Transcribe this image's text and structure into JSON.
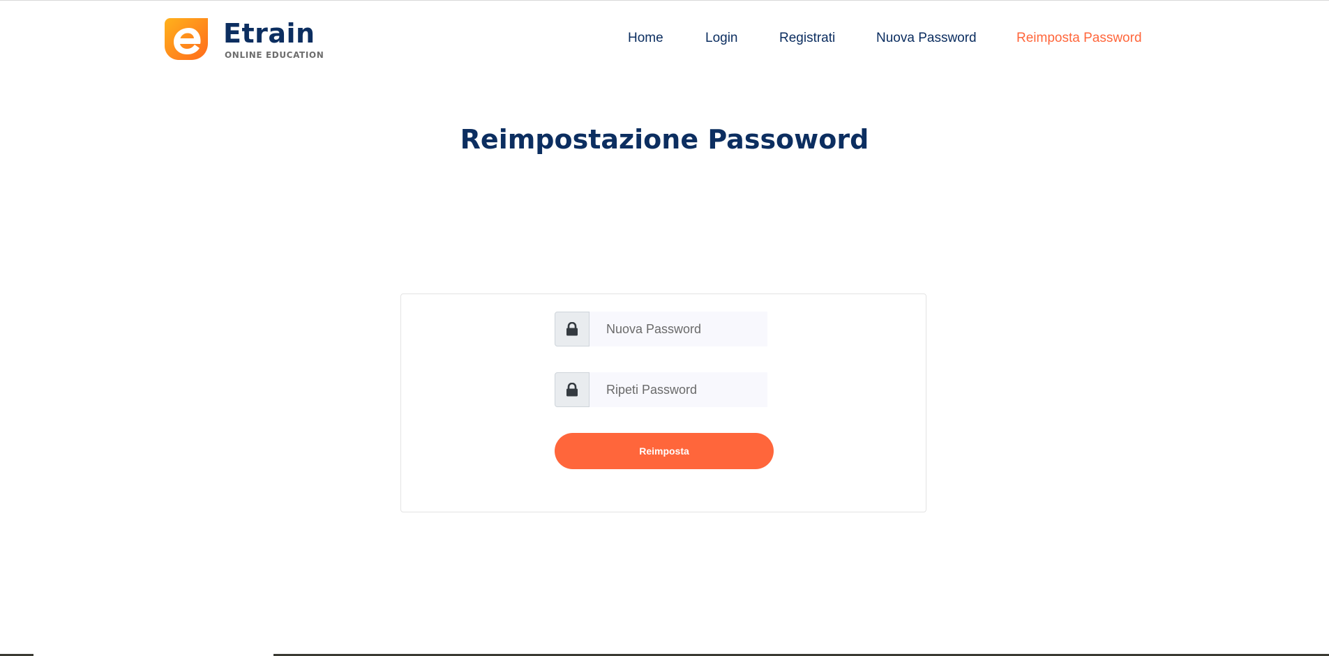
{
  "brand": {
    "name": "Etrain",
    "tagline": "ONLINE EDUCATION",
    "logo_icon": "etrain-e-logo-icon",
    "colors": {
      "navy": "#0c2e60",
      "orange": "#ff663b",
      "yellow": "#ffb21c"
    }
  },
  "nav": {
    "items": [
      {
        "label": "Home",
        "active": false
      },
      {
        "label": "Login",
        "active": false
      },
      {
        "label": "Registrati",
        "active": false
      },
      {
        "label": "Nuova Password",
        "active": false
      },
      {
        "label": "Reimposta Password",
        "active": true
      }
    ]
  },
  "page": {
    "title": "Reimpostazione Passoword"
  },
  "form": {
    "new_password": {
      "placeholder": "Nuova Password",
      "value": "",
      "icon": "lock-icon"
    },
    "repeat_password": {
      "placeholder": "Ripeti Password",
      "value": "",
      "icon": "lock-icon"
    },
    "submit_label": "Reimposta"
  }
}
